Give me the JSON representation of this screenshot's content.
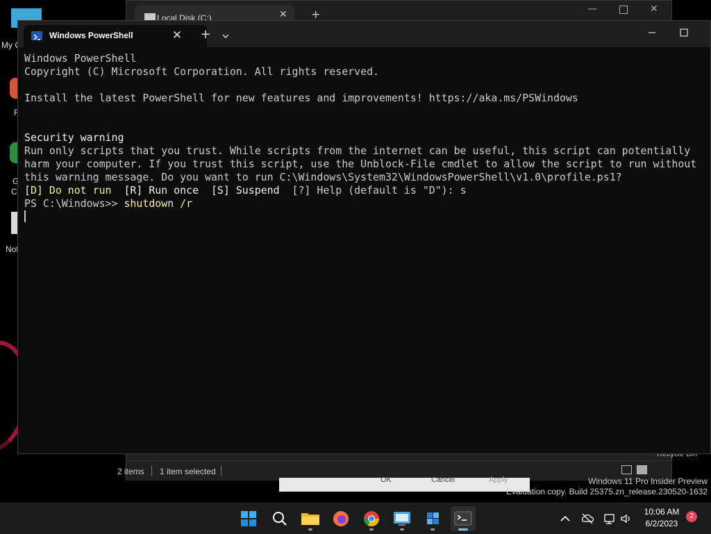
{
  "desktop": {
    "icon_labels": [
      "My C",
      "F",
      "G",
      "C",
      "Not"
    ],
    "recycle_bin_label": "Recycle Bin"
  },
  "explorer": {
    "tab_title": "Local Disk (C:)",
    "status_items": "2 items",
    "status_selected": "1 item selected"
  },
  "dialog": {
    "ok": "OK",
    "cancel": "Cancel",
    "apply": "Apply"
  },
  "watermark": {
    "line1": "Windows 11 Pro Insider Preview",
    "line2": "Evaluation copy. Build 25375.zn_release.230520-1632"
  },
  "terminal": {
    "tab_title": "Windows PowerShell",
    "new_tab_glyph": "+",
    "lines": {
      "l1": "Windows PowerShell",
      "l2": "Copyright (C) Microsoft Corporation. All rights reserved.",
      "l3": "Install the latest PowerShell for new features and improvements! https://aka.ms/PSWindows",
      "l4": "Security warning",
      "l5": "Run only scripts that you trust. While scripts from the internet can be useful, this script can potentially",
      "l6": "harm your computer. If you trust this script, use the Unblock-File cmdlet to allow the script to run without",
      "l7": "this warning message. Do you want to run C:\\Windows\\System32\\WindowsPowerShell\\v1.0\\profile.ps1?",
      "l8_opt_d": "[D] Do not run  ",
      "l8_opt_r": "[R] Run once  ",
      "l8_opt_s": "[S] Suspend  ",
      "l8_rest": "[?] Help (default is \"D\"): s",
      "l9_prompt": "PS C:\\Windows>> ",
      "l9_command": "shutdown /r"
    }
  },
  "taskbar": {
    "apps": [
      "start",
      "search",
      "file-explorer",
      "firefox",
      "chrome",
      "remote-desktop",
      "app",
      "terminal"
    ],
    "time": "10:06 AM",
    "date": "6/2/2023",
    "notification_count": "2"
  },
  "colors": {
    "console_bg": "#0c0c0c",
    "console_text": "#cccccc",
    "command_yellow": "#f9f1a5",
    "accent_blue": "#1e5aa8",
    "badge_red": "#e0485a"
  }
}
